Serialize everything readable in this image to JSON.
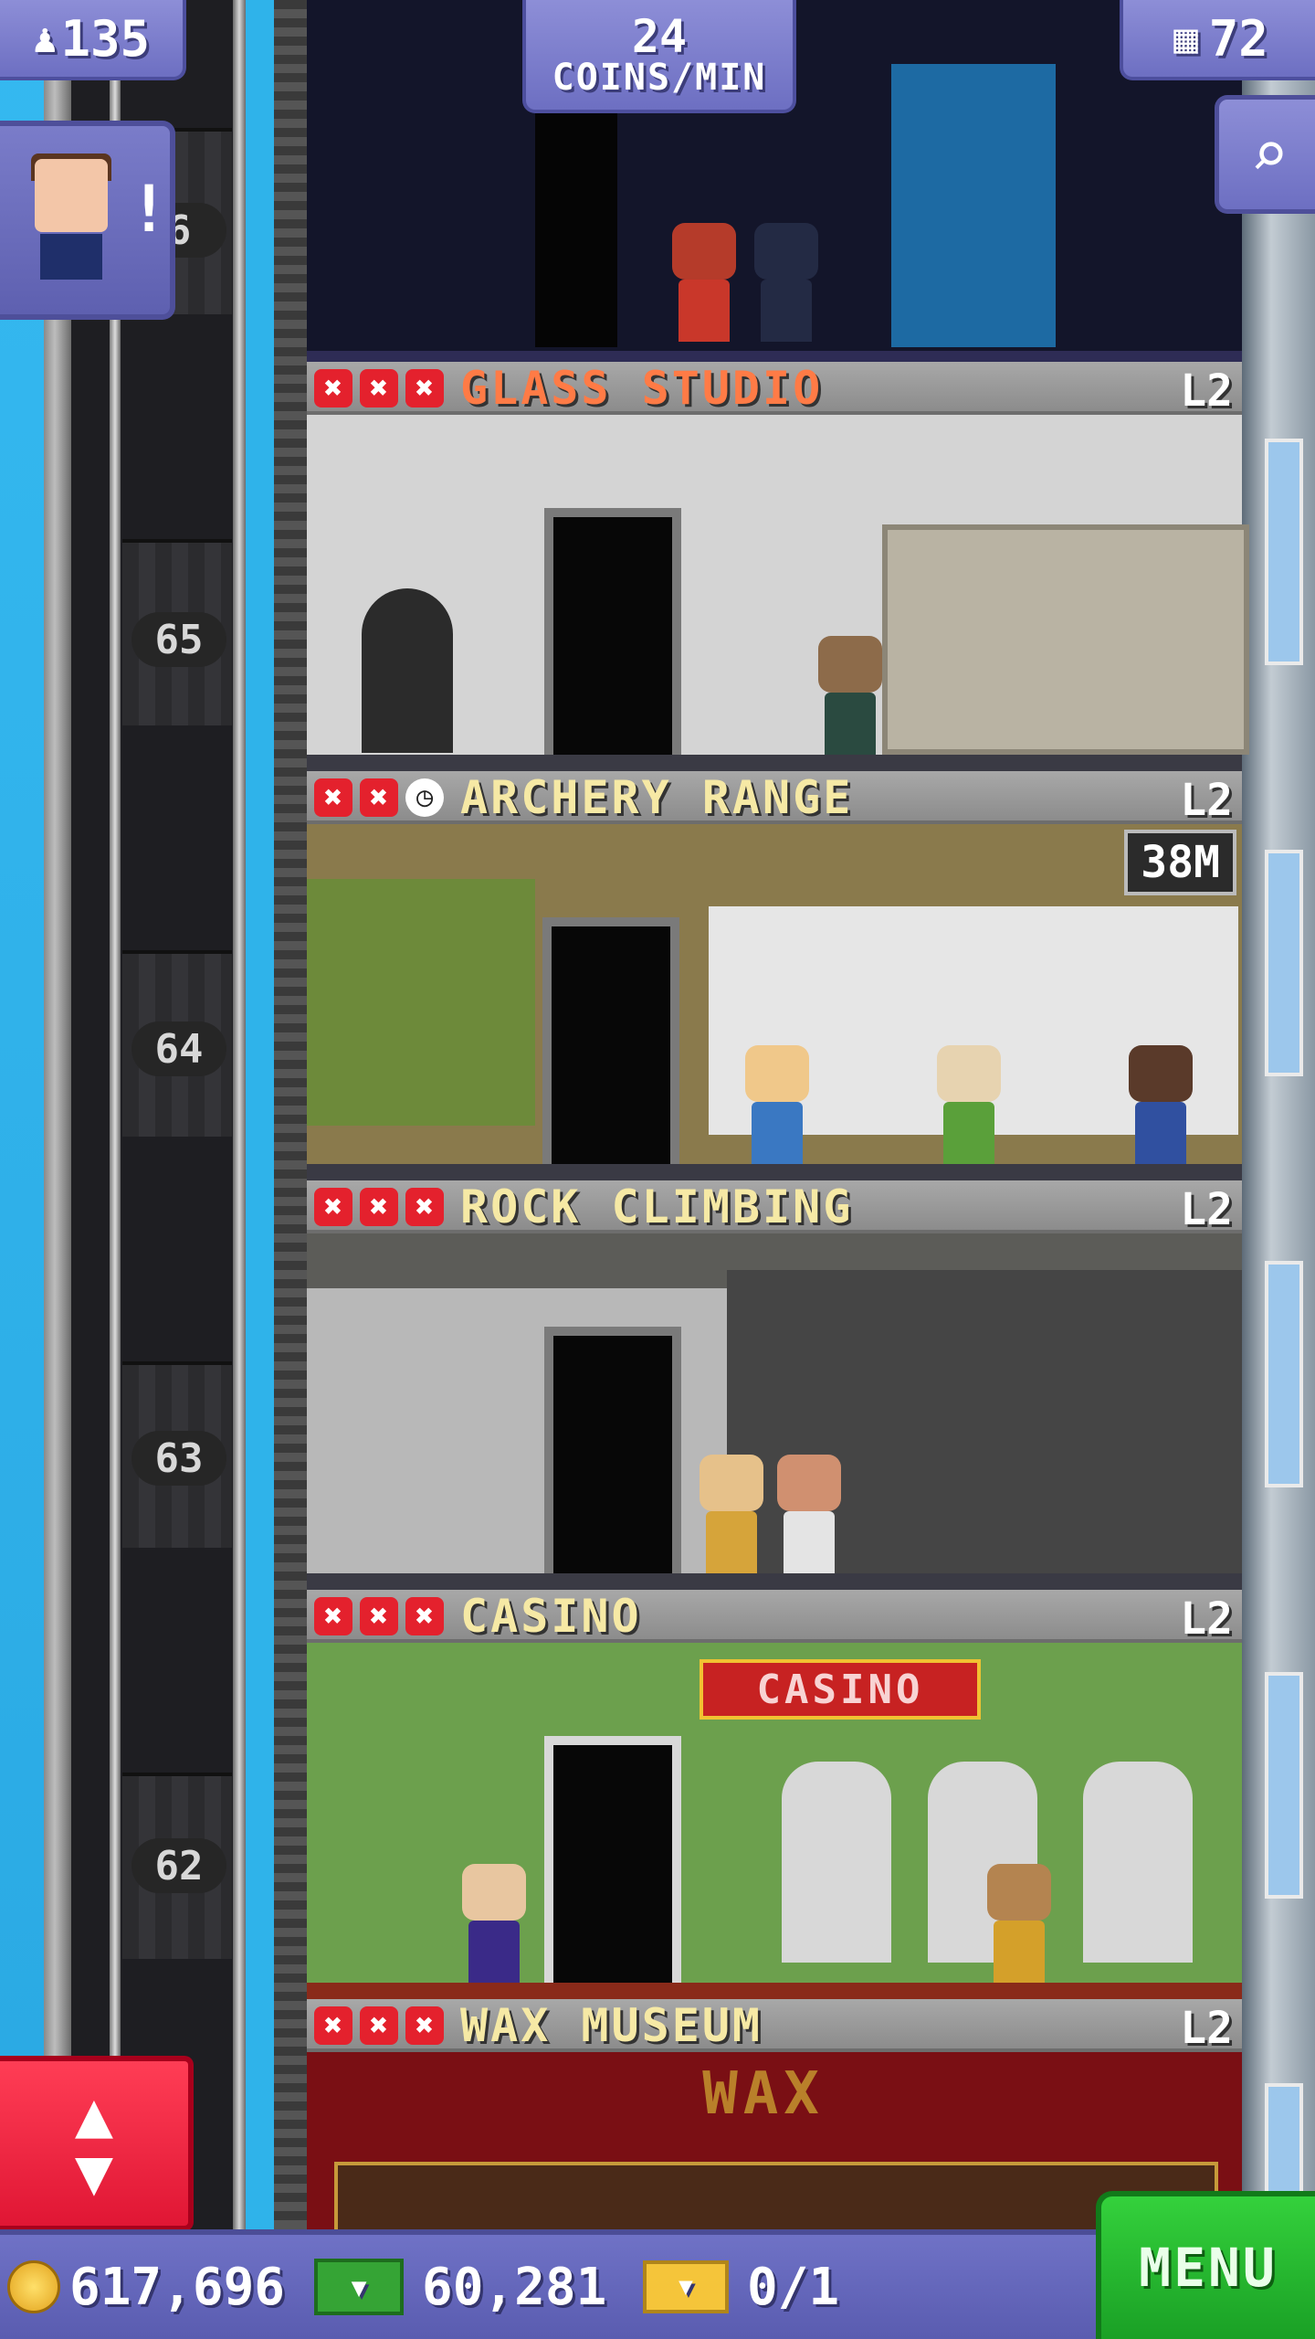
{
  "hud": {
    "population": "135",
    "coins_per_min_value": "24",
    "coins_per_min_label": "COINS/MIN",
    "floors": "72"
  },
  "avatar": {
    "alert": "!"
  },
  "elevator": {
    "floor_numbers": [
      "6",
      "65",
      "64",
      "63",
      "62"
    ]
  },
  "floors": [
    {
      "name": "GLASS STUDIO",
      "level": "L2",
      "status": [
        "x",
        "x",
        "x"
      ],
      "name_color": "#ff7b46",
      "room_color": "#d4d4d4"
    },
    {
      "name": "ARCHERY RANGE",
      "level": "L2",
      "status": [
        "x",
        "x",
        "clock"
      ],
      "timer": "38M",
      "name_color": "#f6e9a5",
      "room_color": "#8a7a4c"
    },
    {
      "name": "ROCK CLIMBING",
      "level": "L2",
      "status": [
        "x",
        "x",
        "x"
      ],
      "name_color": "#f6e9a5",
      "room_color": "#5c5c58"
    },
    {
      "name": "CASINO",
      "level": "L2",
      "status": [
        "x",
        "x",
        "x"
      ],
      "sign": "CASINO",
      "name_color": "#f6e9a5",
      "room_color": "#6ca04d"
    },
    {
      "name": "WAX MUSEUM",
      "level": "L2",
      "status": [
        "x",
        "x",
        "x"
      ],
      "sign": "WAX",
      "name_color": "#f6e9a5",
      "room_color": "#7a0f14"
    }
  ],
  "bottom": {
    "coins": "617,696",
    "bux": "60,281",
    "tickets": "0/1",
    "menu_label": "MENU"
  },
  "icons": {
    "population": "person-icon",
    "floors": "building-icon",
    "search": "magnifier-icon",
    "elevator": "up-down-arrows-icon",
    "coin": "coin-icon",
    "bux": "tower-bux-icon",
    "ticket": "golden-ticket-icon"
  }
}
